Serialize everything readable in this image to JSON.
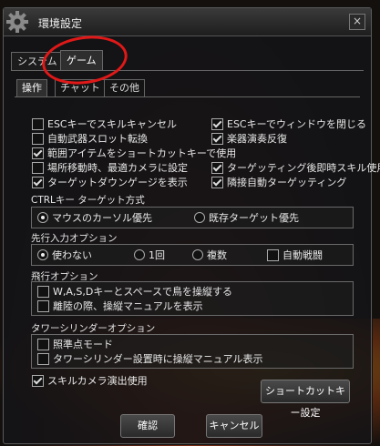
{
  "window": {
    "title": "環境設定",
    "close_label": "×"
  },
  "tabs": [
    "システム",
    "ゲーム"
  ],
  "subtabs": [
    "操作",
    "チャット",
    "その他"
  ],
  "options_left": [
    {
      "label": "ESCキーでスキルキャンセル",
      "checked": false
    },
    {
      "label": "自動武器スロット転換",
      "checked": false
    },
    {
      "label": "範囲アイテムをショートカットキーで使用",
      "checked": true
    },
    {
      "label": "場所移動時、最適カメラに設定",
      "checked": false
    },
    {
      "label": "ターゲットダウンゲージを表示",
      "checked": true
    }
  ],
  "options_right": [
    {
      "label": "ESCキーでウィンドウを閉じる",
      "checked": true
    },
    {
      "label": "楽器演奏反復",
      "checked": true
    },
    {
      "label": "ターゲッティング後即時スキル使用",
      "checked": true
    },
    {
      "label": "隣接自動ターゲッティング",
      "checked": true
    }
  ],
  "ctrl_section": {
    "label": "CTRLキー ターゲット方式",
    "options": [
      "マウスのカーソル優先",
      "既存ターゲット優先"
    ],
    "selected": 0
  },
  "preinput_section": {
    "label": "先行入力オプション",
    "options": [
      "使わない",
      "1回",
      "複数"
    ],
    "selected": 0,
    "auto_label": "自動戦闘",
    "auto_checked": false
  },
  "flight_section": {
    "label": "飛行オプション",
    "options": [
      {
        "label": "W,A,S,Dキーとスペースで鳥を操縦する",
        "checked": false
      },
      {
        "label": "離陸の際、操縦マニュアルを表示",
        "checked": false
      }
    ]
  },
  "tower_section": {
    "label": "タワーシリンダーオプション",
    "options": [
      {
        "label": "照準点モード",
        "checked": false
      },
      {
        "label": "タワーシリンダー設置時に操縦マニュアル表示",
        "checked": false
      }
    ]
  },
  "skill_camera": {
    "label": "スキルカメラ演出使用",
    "checked": true
  },
  "buttons": {
    "shortcut": "ショートカットキー設定",
    "ok": "確認",
    "cancel": "キャンセル"
  },
  "colors": {
    "annotation_circle": "#e01818"
  }
}
